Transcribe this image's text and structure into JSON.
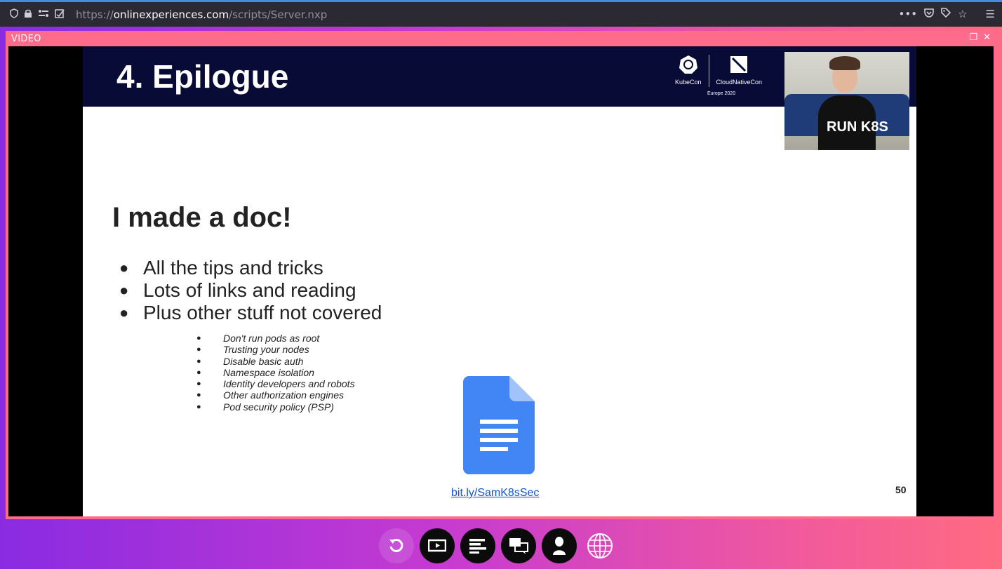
{
  "browser": {
    "url_scheme": "https://",
    "url_host": "onlinexperiences.com",
    "url_path": "/scripts/Server.nxp",
    "left_icons": [
      "shield-icon",
      "lock-icon",
      "permissions-icon",
      "tracking-icon"
    ],
    "right_icons": [
      "more-icon",
      "pocket-icon",
      "bookmark-tag-icon",
      "star-icon",
      "menu-icon"
    ]
  },
  "panel": {
    "title": "VIDEO",
    "controls": [
      "restore-icon",
      "close-icon"
    ]
  },
  "slide": {
    "title": "4. Epilogue",
    "logos": [
      "KubeCon",
      "CloudNativeCon"
    ],
    "event_subtitle": "Europe 2020",
    "webcam_shirt_text": "RUN K8S",
    "heading": "I made a doc!",
    "bullets": [
      "All the tips and tricks",
      "Lots of links and reading",
      "Plus other stuff not covered"
    ],
    "sub_bullets": [
      "Don't run pods as root",
      "Trusting your nodes",
      "Disable basic auth",
      "Namespace isolation",
      "Identity developers and robots",
      "Other authorization engines",
      "Pod security policy (PSP)"
    ],
    "doc_link": "bit.ly/SamK8sSec",
    "page_number": "50"
  },
  "toolbar": {
    "buttons": [
      "refresh-icon",
      "presentation-icon",
      "agenda-icon",
      "chat-icon",
      "profile-icon",
      "language-icon"
    ]
  },
  "colors": {
    "panel_border": "#ff6b8a",
    "slide_header": "#070b35",
    "doc_blue": "#4285f4",
    "link": "#1155cc"
  }
}
